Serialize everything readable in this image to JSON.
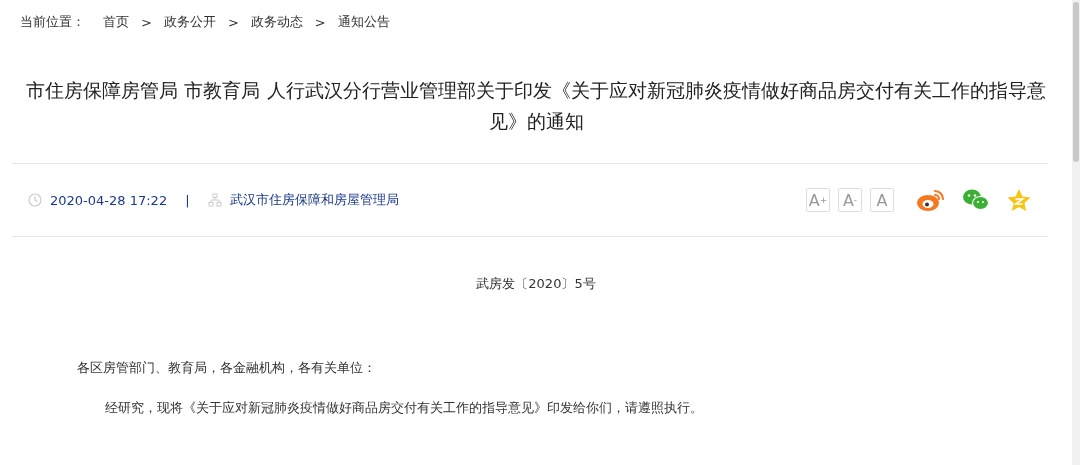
{
  "breadcrumb": {
    "label": "当前位置：",
    "items": [
      "首页",
      "政务公开",
      "政务动态",
      "通知公告"
    ],
    "separator": ">"
  },
  "title": "市住房保障房管局 市教育局 人行武汉分行营业管理部关于印发《关于应对新冠肺炎疫情做好商品房交付有关工作的指导意见》的通知",
  "meta": {
    "date": "2020-04-28 17:22",
    "divider": "|",
    "source": "武汉市住房保障和房屋管理局",
    "font_buttons": [
      "A$^{+}$",
      "A$^{-}$",
      "A"
    ]
  },
  "doc_number": "武房发〔2020〕5号",
  "salutation": "各区房管部门、教育局，各金融机构，各有关单位：",
  "body": "经研究，现将《关于应对新冠肺炎疫情做好商品房交付有关工作的指导意见》印发给你们，请遵照执行。"
}
